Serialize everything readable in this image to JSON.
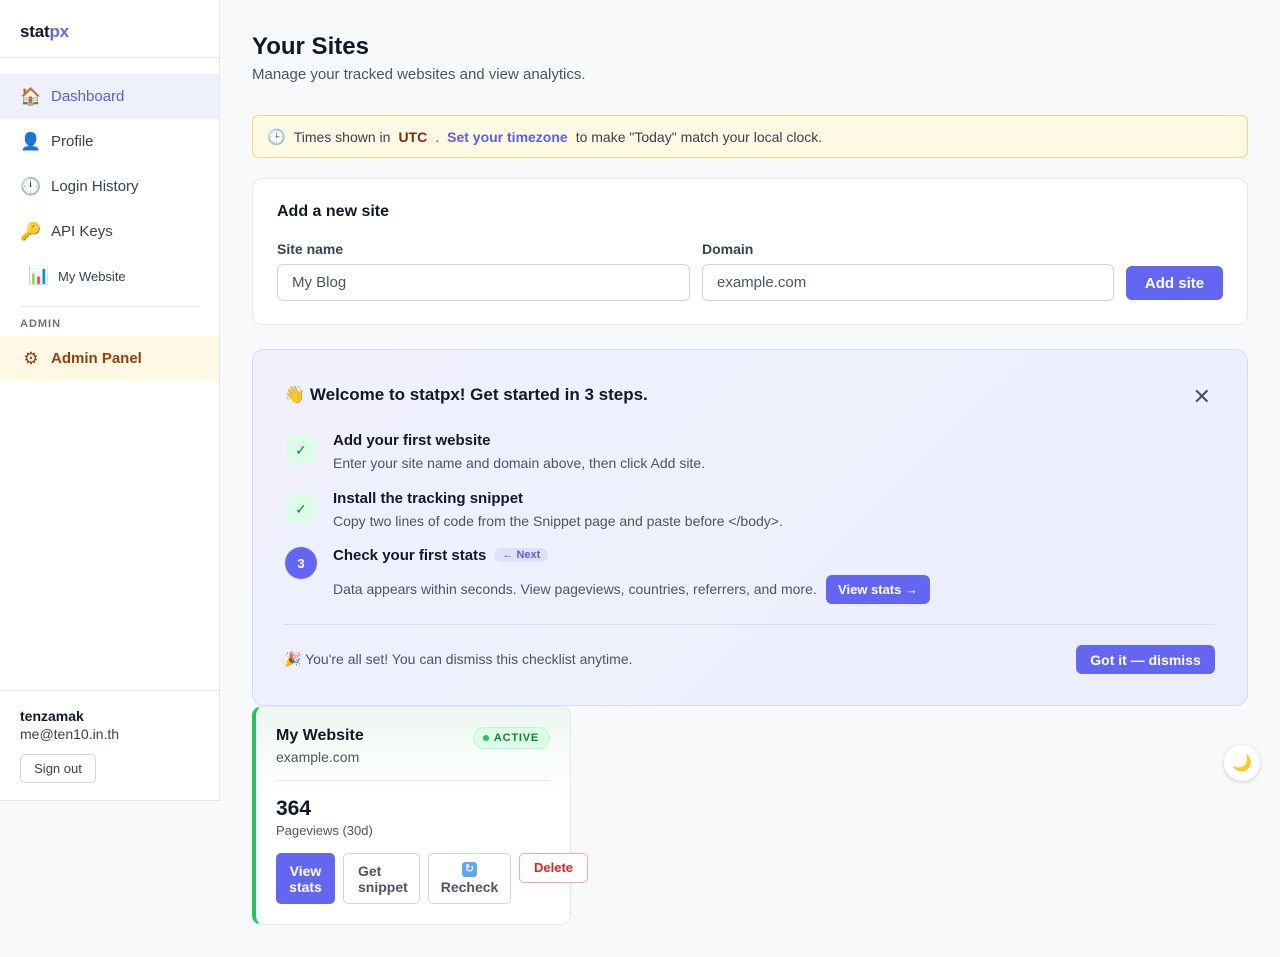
{
  "brand": {
    "prefix": "stat",
    "suffix": "px"
  },
  "sidebar": {
    "items": [
      {
        "icon": "🏠",
        "label": "Dashboard"
      },
      {
        "icon": "👤",
        "label": "Profile"
      },
      {
        "icon": "🕛",
        "label": "Login History"
      },
      {
        "icon": "🔑",
        "label": "API Keys"
      },
      {
        "icon": "📊",
        "label": "My Website"
      }
    ],
    "admin_section": "ADMIN",
    "admin_item": {
      "icon": "⚙",
      "label": "Admin Panel"
    }
  },
  "user": {
    "name": "tenzamak",
    "email": "me@ten10.in.th",
    "signout": "Sign out"
  },
  "page": {
    "title": "Your Sites",
    "subtitle": "Manage your tracked websites and view analytics."
  },
  "tz_banner": {
    "icon": "🕒",
    "prefix": "Times shown in",
    "tz": "UTC",
    "dot": ".",
    "link": "Set your timezone",
    "suffix": "to make \"Today\" match your local clock."
  },
  "add_site": {
    "title": "Add a new site",
    "site_name_label": "Site name",
    "site_name_placeholder": "My Blog",
    "domain_label": "Domain",
    "domain_placeholder": "example.com",
    "button": "Add site"
  },
  "welcome": {
    "title": "👋 Welcome to statpx! Get started in 3 steps.",
    "close": "✕",
    "steps": [
      {
        "badge": "✓",
        "title": "Add your first website",
        "desc": "Enter your site name and domain above, then click Add site."
      },
      {
        "badge": "✓",
        "title": "Install the tracking snippet",
        "desc": "Copy two lines of code from the Snippet page and paste before </body>."
      },
      {
        "badge": "3",
        "title": "Check your first stats",
        "pill": "← Next",
        "desc": "Data appears within seconds. View pageviews, countries, referrers, and more.",
        "button": "View stats →"
      }
    ],
    "footer": "🎉 You're all set! You can dismiss this checklist anytime.",
    "dismiss": "Got it — dismiss"
  },
  "site_card": {
    "name": "My Website",
    "domain": "example.com",
    "status": "ACTIVE",
    "count": "364",
    "count_label": "Pageviews (30d)",
    "btn_view": [
      "View",
      "stats"
    ],
    "btn_snippet": [
      "Get",
      "snippet"
    ],
    "btn_recheck": "Recheck",
    "btn_delete": "Delete"
  },
  "theme_toggle": "🌙",
  "colors": {
    "accent": "#6366f1",
    "active_green": "#22c55e",
    "danger": "#dc2626"
  }
}
